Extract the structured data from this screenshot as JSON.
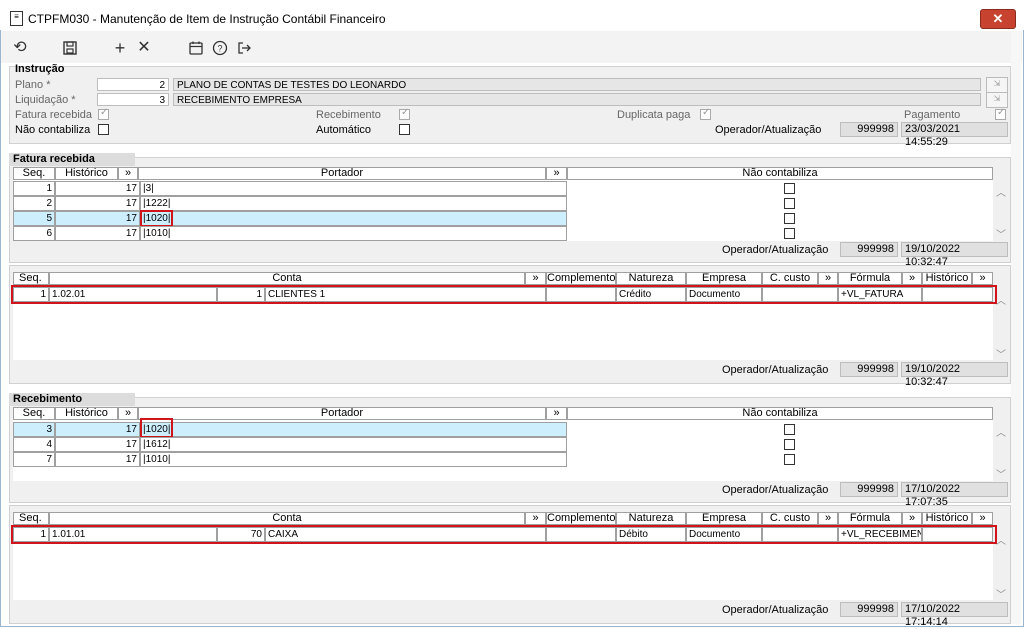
{
  "window": {
    "title": "CTPFM030 - Manutenção de Item de Instrução Contábil Financeiro",
    "close_label": "✕"
  },
  "toolbar": {
    "icons": [
      "undo-icon",
      "save-icon",
      "add-icon",
      "delete-icon",
      "calendar-icon",
      "help-icon",
      "exit-icon"
    ]
  },
  "instrucao": {
    "title": "Instrução",
    "plano_label": "Plano *",
    "plano_code": "2",
    "plano_desc": "PLANO DE CONTAS DE TESTES DO LEONARDO",
    "liquidacao_label": "Liquidação *",
    "liquidacao_code": "3",
    "liquidacao_desc": "RECEBIMENTO EMPRESA",
    "fatura_recebida_label": "Fatura recebida",
    "recebimento_label": "Recebimento",
    "duplicata_paga_label": "Duplicata paga",
    "pagamento_label": "Pagamento",
    "nao_contabiliza_label": "Não contabiliza",
    "automatico_label": "Automático",
    "operador_label": "Operador/Atualização",
    "operador": "999998",
    "atualizacao": "23/03/2021 14:55:29"
  },
  "fatura": {
    "title": "Fatura recebida",
    "headers": {
      "seq": "Seq.",
      "historico": "Histórico",
      "more1": "»",
      "portador": "Portador",
      "more2": "»",
      "nao_contabiliza": "Não contabiliza"
    },
    "rows": [
      {
        "seq": "1",
        "historico": "17",
        "portador": "|3|"
      },
      {
        "seq": "2",
        "historico": "17",
        "portador": "|1222|"
      },
      {
        "seq": "5",
        "historico": "17",
        "portador": "|1020|"
      },
      {
        "seq": "6",
        "historico": "17",
        "portador": "|1010|"
      }
    ],
    "operador_label": "Operador/Atualização",
    "operador": "999998",
    "atualizacao": "19/10/2022 10:32:47"
  },
  "fatura_conta": {
    "headers": {
      "seq": "Seq.",
      "conta": "Conta",
      "more1": "»",
      "complemento": "Complemento",
      "natureza": "Natureza",
      "empresa": "Empresa",
      "ccusto": "C. custo",
      "more2": "»",
      "formula": "Fórmula",
      "more3": "»",
      "historico": "Histórico",
      "more4": "»"
    },
    "row": {
      "seq": "1",
      "conta_code": "1.02.01",
      "conta_num": "1",
      "conta_desc": "CLIENTES 1",
      "natureza": "Crédito",
      "empresa": "Documento",
      "formula": "+VL_FATURA"
    },
    "operador_label": "Operador/Atualização",
    "operador": "999998",
    "atualizacao": "19/10/2022 10:32:47"
  },
  "recebimento": {
    "title": "Recebimento",
    "headers": {
      "seq": "Seq.",
      "historico": "Histórico",
      "more1": "»",
      "portador": "Portador",
      "more2": "»",
      "nao_contabiliza": "Não contabiliza"
    },
    "rows": [
      {
        "seq": "3",
        "historico": "17",
        "portador": "|1020|"
      },
      {
        "seq": "4",
        "historico": "17",
        "portador": "|1612|"
      },
      {
        "seq": "7",
        "historico": "17",
        "portador": "|1010|"
      }
    ],
    "operador_label": "Operador/Atualização",
    "operador": "999998",
    "atualizacao": "17/10/2022 17:07:35"
  },
  "recebimento_conta": {
    "headers": {
      "seq": "Seq.",
      "conta": "Conta",
      "more1": "»",
      "complemento": "Complemento",
      "natureza": "Natureza",
      "empresa": "Empresa",
      "ccusto": "C. custo",
      "more2": "»",
      "formula": "Fórmula",
      "more3": "»",
      "historico": "Histórico",
      "more4": "»"
    },
    "row": {
      "seq": "1",
      "conta_code": "1.01.01",
      "conta_num": "70",
      "conta_desc": "CAIXA",
      "natureza": "Débito",
      "empresa": "Documento",
      "formula": "+VL_RECEBIMEN"
    },
    "operador_label": "Operador/Atualização",
    "operador": "999998",
    "atualizacao": "17/10/2022 17:14:14"
  },
  "colors": {
    "selected_row": "#cdeefd",
    "highlight_border": "#d0141c",
    "close_button": "#c8432f"
  }
}
